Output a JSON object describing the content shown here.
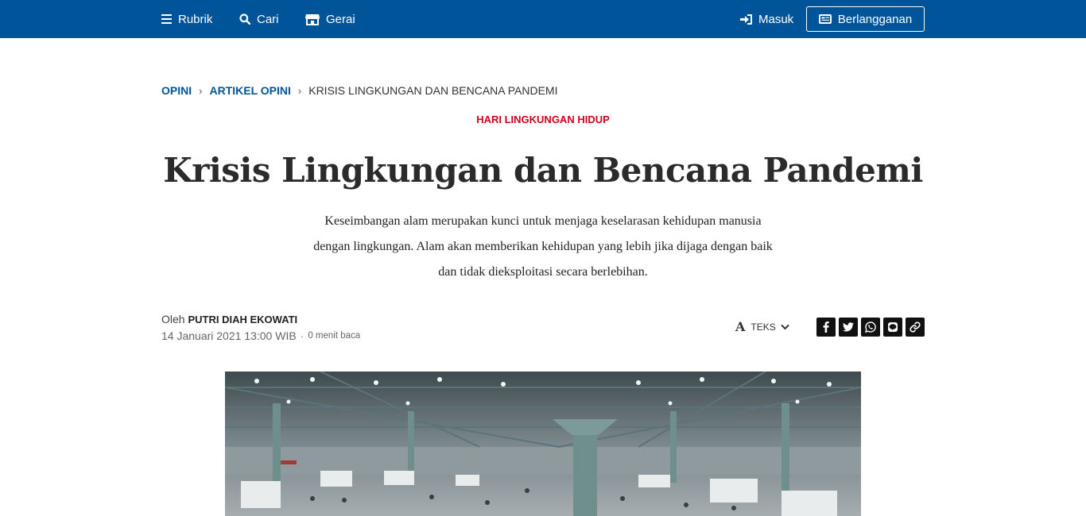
{
  "nav": {
    "rubrik": "Rubrik",
    "cari": "Cari",
    "gerai": "Gerai",
    "masuk": "Masuk",
    "berlangganan": "Berlangganan"
  },
  "breadcrumb": {
    "items": [
      "OPINI",
      "ARTIKEL OPINI"
    ],
    "current": "KRISIS LINGKUNGAN DAN BENCANA PANDEMI",
    "separator": "›"
  },
  "article": {
    "kicker": "HARI LINGKUNGAN HIDUP",
    "title": "Krisis Lingkungan dan Bencana Pandemi",
    "lead_lines": [
      "Keseimbangan alam merupakan kunci untuk menjaga keselarasan kehidupan manusia",
      "dengan lingkungan. Alam akan memberikan kehidupan yang lebih jika dijaga dengan baik",
      "dan tidak dieksploitasi secara berlebihan."
    ],
    "byline_prefix": "Oleh",
    "author": "PUTRI DIAH EKOWATI",
    "date": "14 Januari 2021 13:00 WIB",
    "dot": "·",
    "read_time": "0 menit baca",
    "text_size_label": "TEKS"
  },
  "share": [
    "facebook-icon",
    "twitter-icon",
    "whatsapp-icon",
    "line-icon",
    "link-icon"
  ],
  "colors": {
    "brand_blue": "#00559a",
    "kicker_red": "#d0021b"
  }
}
